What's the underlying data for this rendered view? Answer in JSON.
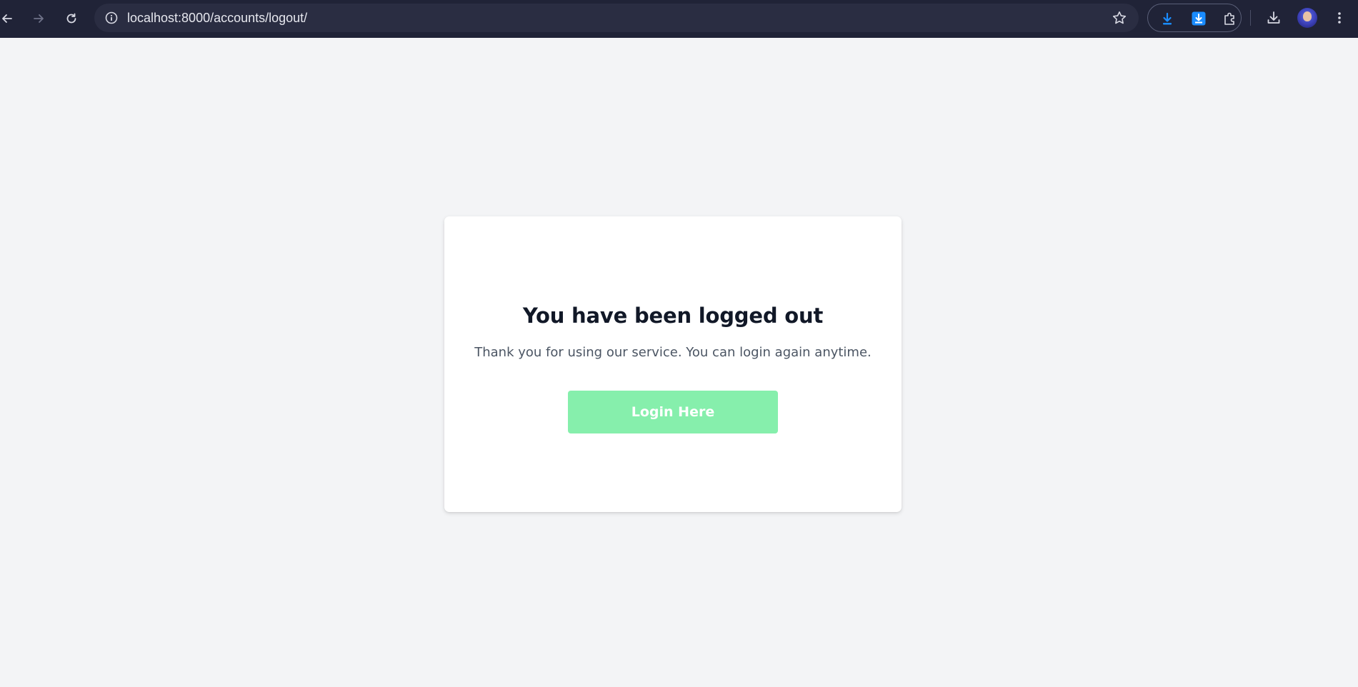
{
  "browser": {
    "url": "localhost:8000/accounts/logout/",
    "icons": {
      "back": "arrow-left-icon",
      "forward": "arrow-right-icon",
      "reload": "reload-icon",
      "site_info": "info-icon",
      "bookmark": "star-icon",
      "extension_1": "download-arrow-icon",
      "extension_2": "download-box-icon",
      "extensions": "puzzle-icon",
      "downloads": "download-icon",
      "profile": "avatar",
      "menu": "kebab-menu-icon"
    }
  },
  "card": {
    "title": "You have been logged out",
    "message": "Thank you for using our service. You can login again anytime.",
    "button_label": "Login Here"
  },
  "colors": {
    "browser_bar": "#202337",
    "page_background": "#f3f4f6",
    "card_background": "#ffffff",
    "button_background": "#86efac",
    "title_text": "#111827",
    "message_text": "#4b5563",
    "extension_accent": "#1a8cff"
  }
}
